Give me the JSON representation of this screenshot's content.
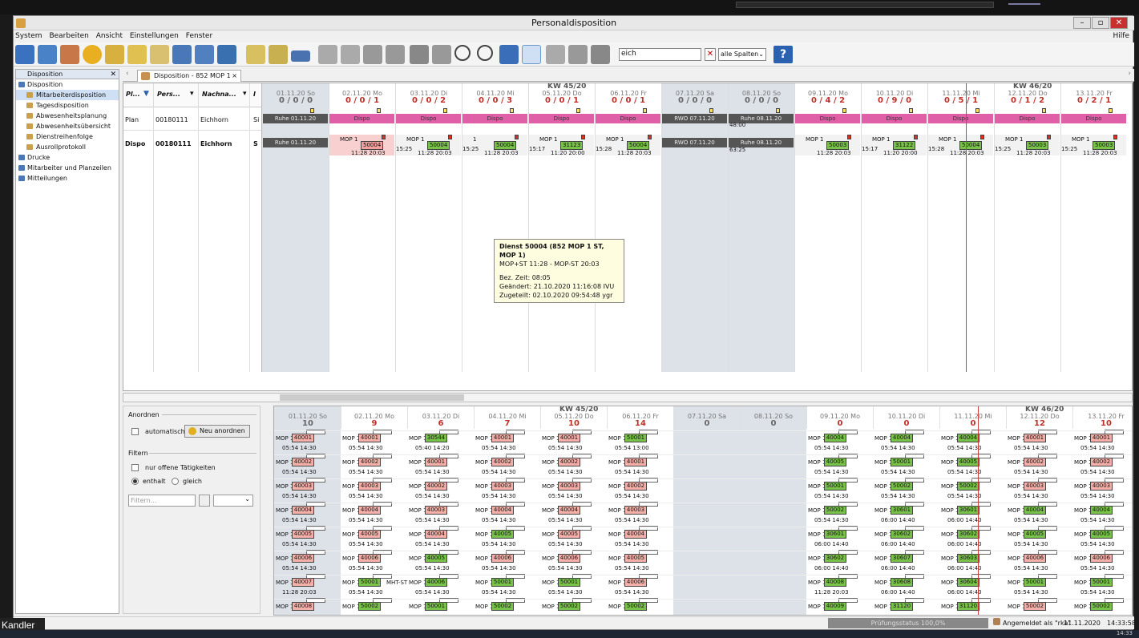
{
  "window": {
    "title": "Personaldisposition",
    "menu_right": "Hilfe"
  },
  "menu": [
    "System",
    "Bearbeiten",
    "Ansicht",
    "Einstellungen",
    "Fenster"
  ],
  "toolbar": {
    "search_value": "eich",
    "column_select": "alle Spalten",
    "help_label": "?"
  },
  "left_panel": {
    "title": "Disposition",
    "items": [
      {
        "label": "Disposition",
        "level": 0
      },
      {
        "label": "Mitarbeiterdisposition",
        "level": 1,
        "selected": true
      },
      {
        "label": "Tagesdisposition",
        "level": 1
      },
      {
        "label": "Abwesenheitsplanung",
        "level": 1
      },
      {
        "label": "Abwesenheitsübersicht",
        "level": 1
      },
      {
        "label": "Dienstreihenfolge",
        "level": 1
      },
      {
        "label": "Ausrollprotokoll",
        "level": 1
      },
      {
        "label": "Drucke",
        "level": 0
      },
      {
        "label": "Mitarbeiter und Planzeilen",
        "level": 0
      },
      {
        "label": "Mitteilungen",
        "level": 0
      }
    ]
  },
  "tab": {
    "label": "Disposition - 852 MOP 1 ST",
    "close": "×"
  },
  "grid_headers": [
    "Pl...",
    "Pers...",
    "Nachna...",
    "I"
  ],
  "rows": [
    {
      "pl": "Plan",
      "pers": "00180111",
      "name": "Eichhorn",
      "extra": "Si"
    },
    {
      "pl": "Dispo",
      "pers": "00180111",
      "name": "Eichhorn",
      "extra": "S"
    }
  ],
  "kw": [
    "KW 45/20",
    "KW 46/20"
  ],
  "days_upper": [
    {
      "date": "01.11.20 So",
      "counts": "0 / 0 / 0",
      "we": true
    },
    {
      "date": "02.11.20 Mo",
      "counts": "0 / 0 / 1"
    },
    {
      "date": "03.11.20 Di",
      "counts": "0 / 0 / 2"
    },
    {
      "date": "04.11.20 Mi",
      "counts": "0 / 0 / 3"
    },
    {
      "date": "05.11.20 Do",
      "counts": "0 / 0 / 1"
    },
    {
      "date": "06.11.20 Fr",
      "counts": "0 / 0 / 1"
    },
    {
      "date": "07.11.20 Sa",
      "counts": "0 / 0 / 0",
      "we": true
    },
    {
      "date": "08.11.20 So",
      "counts": "0 / 0 / 0",
      "we": true
    },
    {
      "date": "09.11.20 Mo",
      "counts": "0 / 4 / 2"
    },
    {
      "date": "10.11.20 Di",
      "counts": "0 / 9 / 0"
    },
    {
      "date": "11.11.20 Mi",
      "counts": "0 / 5 / 1"
    },
    {
      "date": "12.11.20 Do",
      "counts": "0 / 1 / 2"
    },
    {
      "date": "13.11.20 Fr",
      "counts": "0 / 2 / 1"
    }
  ],
  "plan_row": [
    "Ruhe 01.11.20",
    "Dispo",
    "Dispo",
    "Dispo",
    "Dispo",
    "Dispo",
    "RWO 07.11.20",
    "Ruhe 08.11.20",
    "Dispo",
    "Dispo",
    "Dispo",
    "Dispo",
    "Dispo"
  ],
  "plan_extra": [
    "",
    "",
    "",
    "",
    "",
    "",
    "",
    "48:00",
    "",
    "",
    "",
    "",
    ""
  ],
  "dispo_row": [
    {
      "label": "Ruhe 01.11.20",
      "type": "ruhe"
    },
    {
      "mop": "MOP 1",
      "num": "50004",
      "t1": "11:28",
      "t2": "20:03",
      "red": true
    },
    {
      "mop": "MOP 1",
      "num": "50004",
      "pre": "15:25",
      "t1": "11:28",
      "t2": "20:03"
    },
    {
      "mop": "1",
      "num": "50004",
      "pre": "15:25",
      "t1": "11:28",
      "t2": "20:03"
    },
    {
      "mop": "MOP 1",
      "num": "31123",
      "pre": "15:17",
      "t1": "11:20",
      "t2": "20:00"
    },
    {
      "mop": "MOP 1",
      "num": "50004",
      "pre": "15:28",
      "t1": "11:28",
      "t2": "20:03"
    },
    {
      "label": "RWO 07.11.20",
      "type": "ruhe"
    },
    {
      "label": "Ruhe 08.11.20",
      "type": "ruhe",
      "extra": "63:25"
    },
    {
      "mop": "MOP 1",
      "num": "50003",
      "t1": "11:28",
      "t2": "20:03"
    },
    {
      "mop": "MOP 1",
      "num": "31122",
      "pre": "15:17",
      "t1": "11:20",
      "t2": "20:00"
    },
    {
      "mop": "MOP 1",
      "num": "50004",
      "pre": "15:28",
      "t1": "11:28",
      "t2": "20:03"
    },
    {
      "mop": "MOP 1",
      "num": "50003",
      "pre": "15:25",
      "t1": "11:28",
      "t2": "20:03"
    },
    {
      "mop": "MOP 1",
      "num": "50003",
      "pre": "15:25",
      "t1": "11:28",
      "t2": "20:03"
    }
  ],
  "tooltip": {
    "title": "Dienst 50004 (852 MOP 1 ST, MOP 1)",
    "line2": "MOP+ST  11:28  -  MOP-ST  20:03",
    "bez_label": "Bez. Zeit:",
    "bez_value": "08:05",
    "geaendert_label": "Geändert:",
    "geaendert_value": "21.10.2020 11:16:08 IVU",
    "zugeteilt_label": "Zugeteilt:",
    "zugeteilt_value": "02.10.2020 09:54:48 ygr"
  },
  "lower_left": {
    "anordnen": "Anordnen",
    "automatisch": "automatisch",
    "neu_anordnen": "Neu anordnen",
    "filtern": "Filtern",
    "offene": "nur offene Tätigkeiten",
    "enthalt": "enthalt",
    "gleich": "gleich",
    "filter_placeholder": "Filtern..."
  },
  "days_lower": [
    {
      "date": "01.11.20 So",
      "count": "10",
      "we": true
    },
    {
      "date": "02.11.20 Mo",
      "count": "9"
    },
    {
      "date": "03.11.20 Di",
      "count": "6"
    },
    {
      "date": "04.11.20 Mi",
      "count": "7"
    },
    {
      "date": "05.11.20 Do",
      "count": "10"
    },
    {
      "date": "06.11.20 Fr",
      "count": "14"
    },
    {
      "date": "07.11.20 Sa",
      "count": "0",
      "we": true
    },
    {
      "date": "08.11.20 So",
      "count": "0",
      "we": true
    },
    {
      "date": "09.11.20 Mo",
      "count": "0"
    },
    {
      "date": "10.11.20 Di",
      "count": "0"
    },
    {
      "date": "11.11.20 Mi",
      "count": "0"
    },
    {
      "date": "12.11.20 Do",
      "count": "12"
    },
    {
      "date": "13.11.20 Fr",
      "count": "10"
    }
  ],
  "lower_grid": [
    [
      [
        "40001",
        "05:54 14:30",
        "r"
      ],
      [
        "40001",
        "05:54 14:30",
        "r"
      ],
      [
        "30544",
        "05:40 14:20",
        "g"
      ],
      [
        "40001",
        "05:54 14:30",
        "r"
      ],
      [
        "40001",
        "05:54 14:30",
        "r"
      ],
      [
        "50001",
        "05:54 13:00",
        "g"
      ],
      null,
      null,
      [
        "40004",
        "05:54 14:30",
        "g"
      ],
      [
        "40004",
        "05:54 14:30",
        "g"
      ],
      [
        "40004",
        "05:54 14:30",
        "g"
      ],
      [
        "40001",
        "05:54 14:30",
        "r"
      ],
      [
        "40001",
        "05:54 14:30",
        "r"
      ]
    ],
    [
      [
        "40002",
        "05:54 14:30",
        "r"
      ],
      [
        "40002",
        "05:54 14:30",
        "r"
      ],
      [
        "40001",
        "05:54 14:30",
        "r"
      ],
      [
        "40002",
        "05:54 14:30",
        "r"
      ],
      [
        "40002",
        "05:54 14:30",
        "r"
      ],
      [
        "40001",
        "05:54 14:30",
        "r"
      ],
      null,
      null,
      [
        "40005",
        "05:54 14:30",
        "g"
      ],
      [
        "50001",
        "05:54 14:30",
        "g"
      ],
      [
        "40005",
        "05:54 14:30",
        "g"
      ],
      [
        "40002",
        "05:54 14:30",
        "r"
      ],
      [
        "40002",
        "05:54 14:30",
        "r"
      ]
    ],
    [
      [
        "40003",
        "05:54 14:30",
        "r"
      ],
      [
        "40003",
        "05:54 14:30",
        "r"
      ],
      [
        "40002",
        "05:54 14:30",
        "r"
      ],
      [
        "40003",
        "05:54 14:30",
        "r"
      ],
      [
        "40003",
        "05:54 14:30",
        "r"
      ],
      [
        "40002",
        "05:54 14:30",
        "r"
      ],
      null,
      null,
      [
        "50001",
        "05:54 14:30",
        "g"
      ],
      [
        "50002",
        "05:54 14:30",
        "g"
      ],
      [
        "50002",
        "05:54 14:30",
        "g"
      ],
      [
        "40003",
        "05:54 14:30",
        "r"
      ],
      [
        "40003",
        "05:54 14:30",
        "r"
      ]
    ],
    [
      [
        "40004",
        "05:54 14:30",
        "r"
      ],
      [
        "40004",
        "05:54 14:30",
        "r"
      ],
      [
        "40003",
        "05:54 14:30",
        "r"
      ],
      [
        "40004",
        "05:54 14:30",
        "r"
      ],
      [
        "40004",
        "05:54 14:30",
        "r"
      ],
      [
        "40003",
        "05:54 14:30",
        "r"
      ],
      null,
      null,
      [
        "50002",
        "05:54 14:30",
        "g"
      ],
      [
        "30601",
        "06:00 14:40",
        "g"
      ],
      [
        "30601",
        "06:00 14:40",
        "g"
      ],
      [
        "40004",
        "05:54 14:30",
        "g"
      ],
      [
        "40004",
        "05:54 14:30",
        "g"
      ]
    ],
    [
      [
        "40005",
        "05:54 14:30",
        "r"
      ],
      [
        "40005",
        "05:54 14:30",
        "r"
      ],
      [
        "40004",
        "05:54 14:30",
        "r"
      ],
      [
        "40005",
        "05:54 14:30",
        "g"
      ],
      [
        "40005",
        "05:54 14:30",
        "r"
      ],
      [
        "40004",
        "05:54 14:30",
        "r"
      ],
      null,
      null,
      [
        "30601",
        "06:00 14:40",
        "g"
      ],
      [
        "30602",
        "06:00 14:40",
        "g"
      ],
      [
        "30602",
        "06:00 14:40",
        "g"
      ],
      [
        "40005",
        "05:54 14:30",
        "g"
      ],
      [
        "40005",
        "05:54 14:30",
        "g"
      ]
    ],
    [
      [
        "40006",
        "05:54 14:30",
        "r"
      ],
      [
        "40006",
        "05:54 14:30",
        "r"
      ],
      [
        "40005",
        "05:54 14:30",
        "g"
      ],
      [
        "40006",
        "05:54 14:30",
        "r"
      ],
      [
        "40006",
        "05:54 14:30",
        "r"
      ],
      [
        "40005",
        "05:54 14:30",
        "r"
      ],
      null,
      null,
      [
        "30602",
        "06:00 14:40",
        "g"
      ],
      [
        "30607",
        "06:00 14:40",
        "g"
      ],
      [
        "30603",
        "06:00 14:40",
        "g"
      ],
      [
        "40006",
        "05:54 14:30",
        "r"
      ],
      [
        "40006",
        "05:54 14:30",
        "r"
      ]
    ],
    [
      [
        "40007",
        "11:28 20:03",
        "r"
      ],
      [
        "50001",
        "05:54 14:30",
        "g"
      ],
      [
        "40006",
        "05:54 14:30",
        "g"
      ],
      [
        "50001",
        "05:54 14:30",
        "g"
      ],
      [
        "50001",
        "05:54 14:30",
        "g"
      ],
      [
        "40006",
        "05:54 14:30",
        "r"
      ],
      null,
      null,
      [
        "40008",
        "11:28 20:03",
        "g"
      ],
      [
        "30608",
        "06:00 14:40",
        "g"
      ],
      [
        "30604",
        "06:00 14:40",
        "g"
      ],
      [
        "50001",
        "05:54 14:30",
        "g"
      ],
      [
        "50001",
        "05:54 14:30",
        "g"
      ]
    ],
    [
      [
        "40008",
        "",
        "r"
      ],
      [
        "50002",
        "",
        "g"
      ],
      [
        "50001",
        "",
        "g"
      ],
      [
        "50002",
        "",
        "g"
      ],
      [
        "50002",
        "",
        "g"
      ],
      [
        "50002",
        "",
        "g"
      ],
      null,
      null,
      [
        "40009",
        "",
        "g"
      ],
      [
        "31120",
        "",
        "g"
      ],
      [
        "31120",
        "",
        "g"
      ],
      [
        "50002",
        "",
        "r"
      ],
      [
        "50002",
        "",
        "g"
      ]
    ]
  ],
  "lower_extra": "MHT-ST",
  "status": {
    "pruefung": "Prüfungsstatus 100,0%",
    "angemeldet": "Angemeldet als \"rka\"",
    "date": "11.11.2020",
    "time": "14:33:58"
  },
  "overlay": {
    "user": "Kandler",
    "clock": "14:33"
  }
}
